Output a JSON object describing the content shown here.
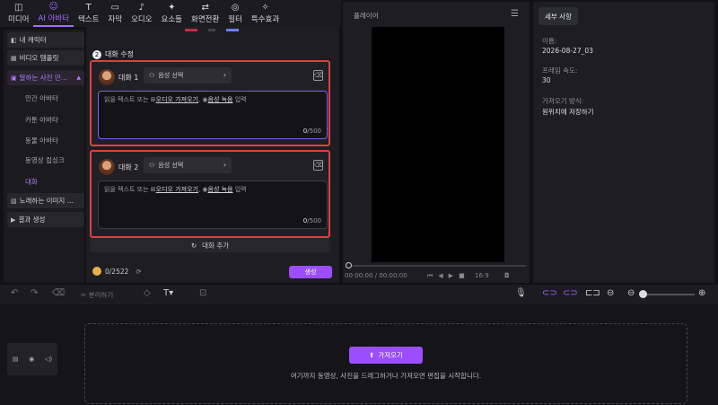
{
  "tabs": [
    {
      "icon": "media-icon",
      "glyph": "◫",
      "label": "미디어"
    },
    {
      "icon": "ai-avatar-icon",
      "glyph": "☺",
      "label": "AI 아바타"
    },
    {
      "icon": "text-icon",
      "glyph": "T",
      "label": "텍스트"
    },
    {
      "icon": "subtitle-icon",
      "glyph": "▭",
      "label": "자막"
    },
    {
      "icon": "audio-icon",
      "glyph": "♪",
      "label": "오디오"
    },
    {
      "icon": "elements-icon",
      "glyph": "✦",
      "label": "요소들"
    },
    {
      "icon": "transition-icon",
      "glyph": "⇄",
      "label": "화면전환"
    },
    {
      "icon": "filter-icon",
      "glyph": "◎",
      "label": "필터"
    },
    {
      "icon": "effects-icon",
      "glyph": "✧",
      "label": "특수효과"
    }
  ],
  "sidebar": {
    "items": [
      {
        "label": "내 캐릭터"
      },
      {
        "label": "비디오 템플릿"
      },
      {
        "label": "말하는 사진 만..."
      },
      {
        "label": "노래하는 이미지 ..."
      },
      {
        "label": "결과 생성"
      }
    ],
    "subs": [
      "인간 아바타",
      "카툰 아바타",
      "동물 아바타",
      "동영상 립싱크",
      "대화"
    ]
  },
  "section": {
    "step": "2",
    "title": "대화 수정"
  },
  "dialogs": [
    {
      "name": "대화 1",
      "voice": "음성 선택",
      "text_pre": "읽을 텍스트 또는 ",
      "link1": "오디오 가져오기",
      "mid": ", ",
      "link2": "음성 녹음",
      "text_post": " 입력",
      "count": "0",
      "max": "/500"
    },
    {
      "name": "대화 2",
      "voice": "음성 선택",
      "text_pre": "읽을 텍스트 또는 ",
      "link1": "오디오 가져오기",
      "mid": ", ",
      "link2": "음성 녹음",
      "text_post": " 입력",
      "count": "0",
      "max": "/500"
    }
  ],
  "add_dialog": "대화 추가",
  "credits": "0/2522",
  "generate": "생성",
  "player": {
    "title": "플레이어",
    "time": "00:00:00 / 00:00:00",
    "ratio": "16:9"
  },
  "details": {
    "tab": "세부 사항",
    "name_label": "이름:",
    "name_value": "2026-08-27_03",
    "fps_label": "프레임 속도:",
    "fps_value": "30",
    "import_label": "가져오기 방식:",
    "import_value": "원위치에 저장하기"
  },
  "timeline": {
    "split_label": "분리하기",
    "import_button": "가져오기",
    "hint": "여기까지 동영상, 사진을 드래그하거나 가져오면 편집을 시작합니다."
  },
  "colors": {
    "accent": "#9b4dff",
    "highlight": "#e0403f"
  }
}
